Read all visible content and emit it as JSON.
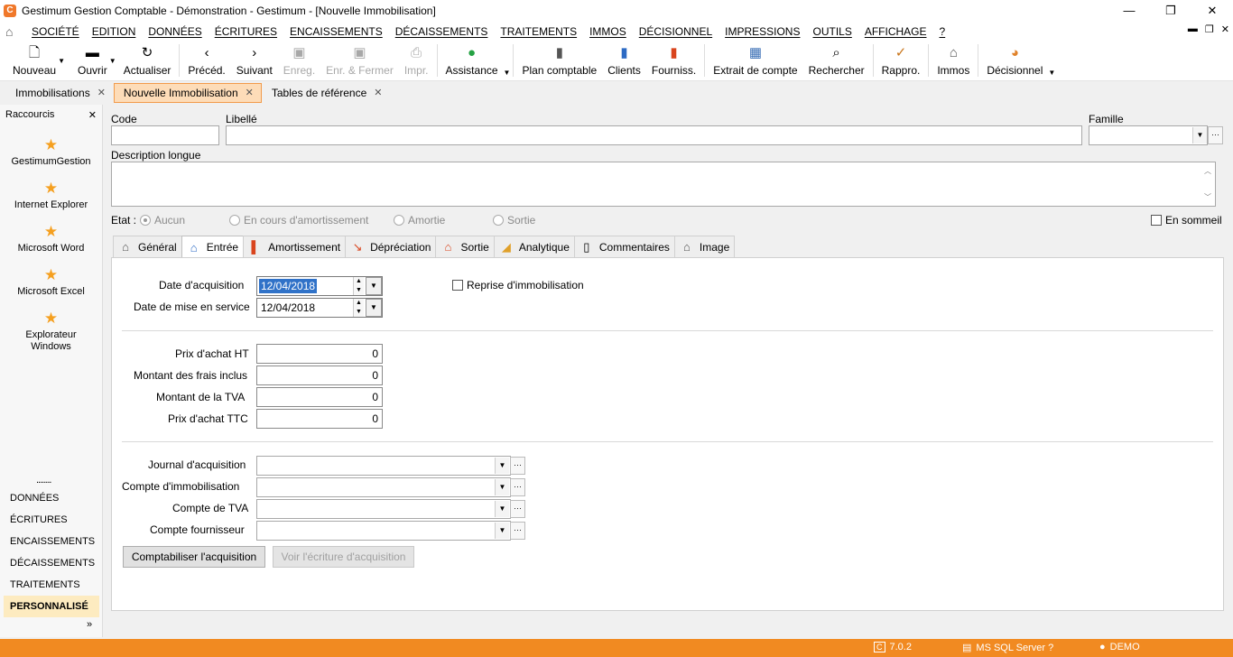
{
  "window": {
    "app_icon": "C",
    "title": "Gestimum Gestion Comptable - Démonstration - Gestimum - [Nouvelle Immobilisation]",
    "minimize": "—",
    "maximize": "❐",
    "close": "✕"
  },
  "menu": {
    "items": [
      "SOCIÉTÉ",
      "EDITION",
      "DONNÉES",
      "ÉCRITURES",
      "ENCAISSEMENTS",
      "DÉCAISSEMENTS",
      "TRAITEMENTS",
      "IMMOS",
      "DÉCISIONNEL",
      "IMPRESSIONS",
      "OUTILS",
      "AFFICHAGE",
      "?"
    ],
    "mdi_minimize": "▬",
    "mdi_restore": "❐",
    "mdi_close": "✕"
  },
  "toolbar": {
    "nouveau": "Nouveau",
    "ouvrir": "Ouvrir",
    "actualiser": "Actualiser",
    "preced": "Précéd.",
    "suivant": "Suivant",
    "enreg": "Enreg.",
    "enr_fermer": "Enr. & Fermer",
    "impr": "Impr.",
    "assistance": "Assistance",
    "plan_comptable": "Plan comptable",
    "clients": "Clients",
    "fourniss": "Fourniss.",
    "extrait": "Extrait de compte",
    "rechercher": "Rechercher",
    "rappro": "Rappro.",
    "immos": "Immos",
    "decisionnel": "Décisionnel"
  },
  "doc_tabs": [
    {
      "label": "Immobilisations",
      "active": false
    },
    {
      "label": "Nouvelle Immobilisation",
      "active": true
    },
    {
      "label": "Tables de référence",
      "active": false
    }
  ],
  "sidebar": {
    "title": "Raccourcis",
    "close": "✕",
    "shortcuts": [
      "GestimumGestion",
      "Internet Explorer",
      "Microsoft Word",
      "Microsoft Excel",
      "Explorateur Windows"
    ],
    "dots": "........",
    "nav": [
      "DONNÉES",
      "ÉCRITURES",
      "ENCAISSEMENTS",
      "DÉCAISSEMENTS",
      "TRAITEMENTS",
      "PERSONNALISÉ"
    ],
    "active_nav": "PERSONNALISÉ",
    "more": "»"
  },
  "form": {
    "code_label": "Code",
    "code_value": "",
    "libelle_label": "Libellé",
    "libelle_value": "",
    "famille_label": "Famille",
    "famille_value": "",
    "description_label": "Description longue",
    "description_value": "",
    "etat_label": "Etat :",
    "etat_options": [
      "Aucun",
      "En cours d'amortissement",
      "Amortie",
      "Sortie"
    ],
    "etat_selected": "Aucun",
    "en_sommeil": "En sommeil",
    "en_sommeil_checked": false
  },
  "form_tabs": [
    "Général",
    "Entrée",
    "Amortissement",
    "Dépréciation",
    "Sortie",
    "Analytique",
    "Commentaires",
    "Image"
  ],
  "active_form_tab": "Entrée",
  "entree": {
    "date_acquisition_label": "Date d'acquisition",
    "date_acquisition": "12/04/2018",
    "date_service_label": "Date de mise en service",
    "date_service": "12/04/2018",
    "reprise_label": "Reprise d'immobilisation",
    "reprise_checked": false,
    "prix_ht_label": "Prix d'achat HT",
    "prix_ht": "0",
    "frais_label": "Montant des frais inclus",
    "frais": "0",
    "tva_label": "Montant de la TVA",
    "tva": "0",
    "prix_ttc_label": "Prix d'achat TTC",
    "prix_ttc": "0",
    "journal_label": "Journal d'acquisition",
    "journal": "",
    "compte_immo_label": "Compte d'immobilisation",
    "compte_immo": "",
    "compte_tva_label": "Compte de TVA",
    "compte_tva": "",
    "compte_fourn_label": "Compte fournisseur",
    "compte_fourn": "",
    "btn_comptabiliser": "Comptabiliser l'acquisition",
    "btn_voir": "Voir l'écriture d'acquisition"
  },
  "status": {
    "version": "7.0.2",
    "server": "MS SQL Server ?",
    "user": "DEMO"
  },
  "colors": {
    "accent": "#f18a21",
    "active_tab": "#fddcb8",
    "selection": "#3072c8"
  }
}
